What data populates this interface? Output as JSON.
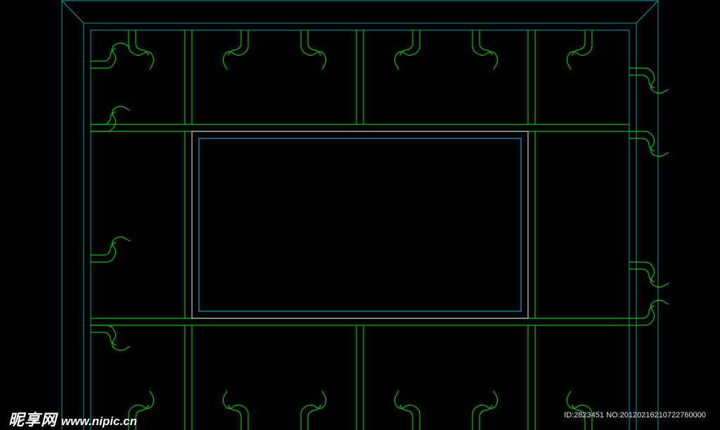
{
  "colors": {
    "background": "#000000",
    "outer_frame": "#00a6a6",
    "lattice": "#00c800",
    "panel_outer": "#c8c8c8",
    "panel_inner": "#00a6d6"
  },
  "watermark": {
    "site_cn": "昵享网",
    "site_url": "www.nipic.cn",
    "id_text": "ID:2823451 NO:20120216210722760000"
  }
}
